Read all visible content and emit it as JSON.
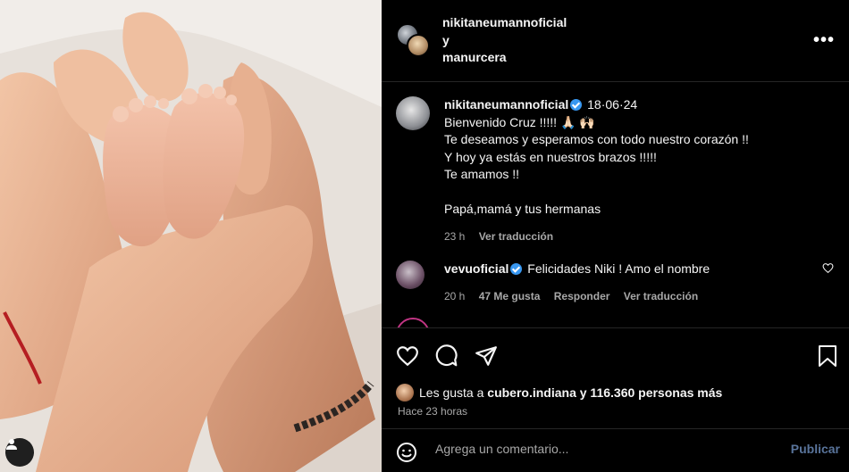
{
  "header": {
    "user1": "nikitaneumannoficial",
    "conjunction": "y",
    "user2": "manurcera",
    "more": "•••"
  },
  "caption": {
    "user": "nikitaneumannoficial",
    "date": "18·06·24",
    "lines": [
      "Bienvenido Cruz !!!!! 🙏🏻 🙌🏻",
      "Te deseamos y esperamos con todo nuestro corazón !!",
      "Y hoy ya estás en nuestros brazos !!!!!",
      "Te amamos !!󠁿"
    ],
    "signature": "Papá,mamá y tus hermanas",
    "time": "23 h",
    "translate": "Ver traducción"
  },
  "comment": {
    "user": "vevuoficial",
    "text": "Felicidades Niki ! Amo el nombre",
    "time": "20 h",
    "likes": "47 Me gusta",
    "reply": "Responder",
    "translate": "Ver traducción"
  },
  "partial_comment": {
    "hearts": "❤ ❤ ❤ ❤ ❤"
  },
  "likes": {
    "prefix": "Les gusta a",
    "user": "cubero.indiana",
    "suffix": "y 116.360 personas más"
  },
  "posted_ago": "Hace 23 horas",
  "composer": {
    "placeholder": "Agrega un comentario...",
    "publish": "Publicar"
  },
  "colors": {
    "background": "#000000",
    "text": "#f5f5f5",
    "muted": "#a8a8a8",
    "verified": "#3897f0",
    "publish_disabled": "#59749b",
    "divider": "#262626"
  }
}
